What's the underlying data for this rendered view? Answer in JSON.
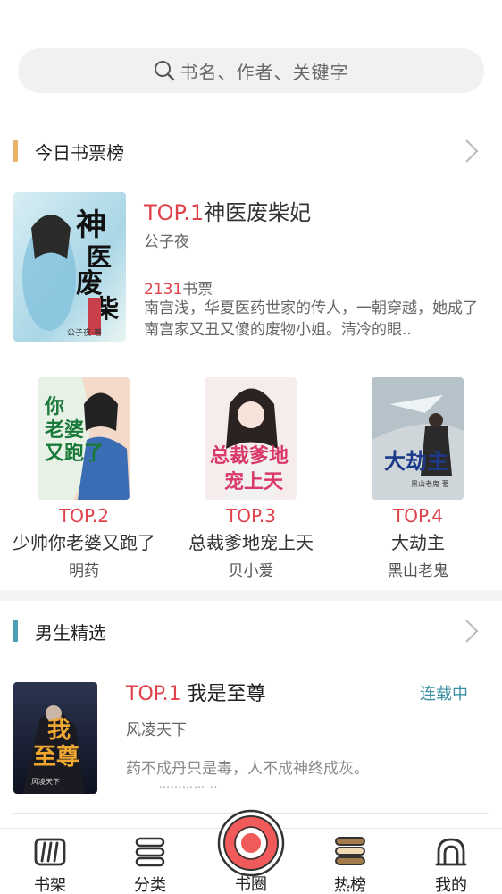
{
  "search": {
    "placeholder": "书名、作者、关键字"
  },
  "ticket_ranking": {
    "title": "今日书票榜",
    "accent": "#e8b46a",
    "top1": {
      "rank": "TOP.1",
      "title": "神医废柴妃",
      "author": "公子夜",
      "votes": "2131",
      "votes_unit": "书票",
      "description": "南宫浅，华夏医药世家的传人，一朝穿越，她成了南宫家又丑又傻的废物小姐。清冷的眼..",
      "cover_text": "神医废柴妃",
      "cover_author": "公子夜·著"
    },
    "others": [
      {
        "rank": "TOP.2",
        "title": "少帅你老婆又跑了",
        "author": "明药",
        "cover_text": "你老婆又跑了"
      },
      {
        "rank": "TOP.3",
        "title": "总裁爹地宠上天",
        "author": "贝小爱",
        "cover_text": "总裁爹地宠上天"
      },
      {
        "rank": "TOP.4",
        "title": "大劫主",
        "author": "黑山老鬼",
        "cover_text": "大劫主"
      }
    ]
  },
  "male_picks": {
    "title": "男生精选",
    "accent": "#4aa0b5",
    "top1": {
      "rank": "TOP.1",
      "title": "我是至尊",
      "status": "连载中",
      "author": "风凌天下",
      "description": "药不成丹只是毒，人不成神终成灰。",
      "ellipsis": "………… ..",
      "cover_text": "我是至尊"
    }
  },
  "tabbar": {
    "items": [
      {
        "label": "书架",
        "icon": "bookshelf-icon"
      },
      {
        "label": "分类",
        "icon": "category-icon"
      },
      {
        "label": "书圈",
        "icon": "circle-icon"
      },
      {
        "label": "热榜",
        "icon": "hot-list-icon"
      },
      {
        "label": "我的",
        "icon": "profile-icon"
      }
    ],
    "center_color": "#f05a5a"
  }
}
